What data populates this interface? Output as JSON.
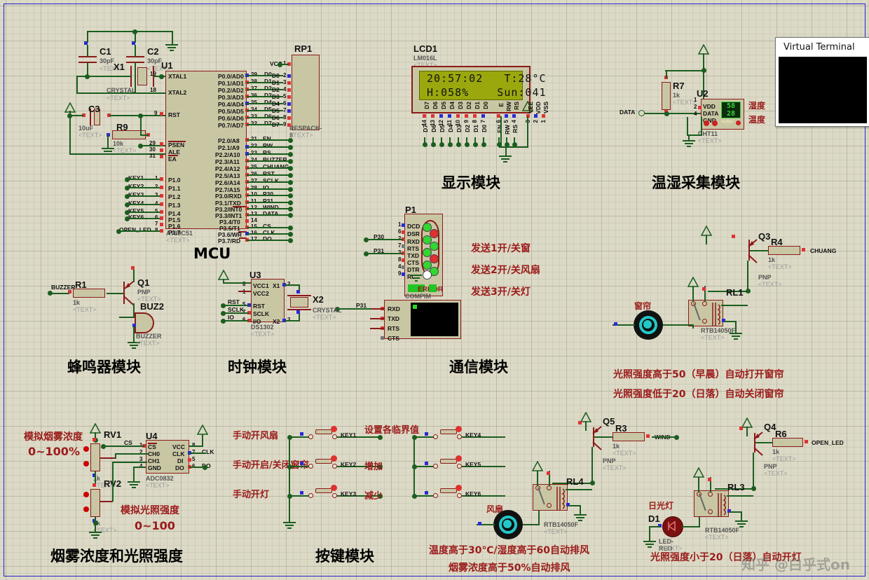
{
  "window": {
    "virtual_terminal_title": "Virtual Terminal"
  },
  "module_titles": {
    "mcu": "MCU",
    "display": "显示模块",
    "temp_humidity": "温湿采集模块",
    "buzzer": "蜂鸣器模块",
    "clock": "时钟模块",
    "communication": "通信模块",
    "smoke_light": "烟雾浓度和光照强度",
    "keys": "按键模块"
  },
  "lcd": {
    "ref": "LCD1",
    "part": "LM016L",
    "text_tag": "<TEXT>",
    "line1": "20:57:02   T:28°C",
    "line2": "H:058%    Sun:041",
    "data_pins": [
      "D7",
      "D6",
      "D5",
      "D4",
      "D3",
      "D2",
      "D1",
      "D0"
    ],
    "data_pin_numbers": [
      "14",
      "13",
      "12",
      "11",
      "10",
      "9",
      "8",
      "7"
    ],
    "ctrl_pins": [
      "E",
      "RW",
      "RS"
    ],
    "ctrl_pin_numbers": [
      "6",
      "5",
      "4"
    ],
    "pwr_pins": [
      "VEE",
      "VDD",
      "VSS"
    ],
    "pwr_pin_numbers": [
      "3",
      "2",
      "1"
    ]
  },
  "mcu": {
    "ref": "U1",
    "part": "AT89C51",
    "text_tag": "<TEXT>",
    "left_pins": [
      {
        "num": "19",
        "label": "XTAL1"
      },
      {
        "num": "18",
        "label": "XTAL2"
      },
      {
        "num": "9",
        "label": "RST"
      },
      {
        "num": "29",
        "label": "PSEN"
      },
      {
        "num": "30",
        "label": "ALE"
      },
      {
        "num": "31",
        "label": "EA"
      },
      {
        "num": "1",
        "label": "P1.0",
        "net": "KEY1"
      },
      {
        "num": "2",
        "label": "P1.1",
        "net": "KEY2"
      },
      {
        "num": "3",
        "label": "P1.2",
        "net": "KEY3"
      },
      {
        "num": "4",
        "label": "P1.3",
        "net": "KEY4"
      },
      {
        "num": "5",
        "label": "P1.4",
        "net": "KEY5"
      },
      {
        "num": "6",
        "label": "P1.5",
        "net": "KEY6"
      },
      {
        "num": "7",
        "label": "P1.6",
        "net": ""
      },
      {
        "num": "8",
        "label": "P1.7",
        "net": "OPEN_LED"
      }
    ],
    "right_pins": [
      {
        "num": "39",
        "label": "P0.0/AD0",
        "net": "D0"
      },
      {
        "num": "38",
        "label": "P0.1/AD1",
        "net": "D1"
      },
      {
        "num": "37",
        "label": "P0.2/AD2",
        "net": "D2"
      },
      {
        "num": "36",
        "label": "P0.3/AD3",
        "net": "D3"
      },
      {
        "num": "35",
        "label": "P0.4/AD4",
        "net": "D4"
      },
      {
        "num": "34",
        "label": "P0.5/AD5",
        "net": "D5"
      },
      {
        "num": "33",
        "label": "P0.6/AD6",
        "net": "D6"
      },
      {
        "num": "32",
        "label": "P0.7/AD7",
        "net": "D7"
      },
      {
        "num": "21",
        "label": "P2.0/A8",
        "net": "EN"
      },
      {
        "num": "22",
        "label": "P2.1/A9",
        "net": "RW"
      },
      {
        "num": "23",
        "label": "P2.2/A10",
        "net": "RS"
      },
      {
        "num": "24",
        "label": "P2.3/A11",
        "net": "BUZZER"
      },
      {
        "num": "25",
        "label": "P2.4/A12",
        "net": "CHUANG"
      },
      {
        "num": "26",
        "label": "P2.5/A13",
        "net": "RST"
      },
      {
        "num": "27",
        "label": "P2.6/A14",
        "net": "SCLK"
      },
      {
        "num": "28",
        "label": "P2.7/A15",
        "net": "IO"
      },
      {
        "num": "10",
        "label": "P3.0/RXD",
        "net": "P30"
      },
      {
        "num": "11",
        "label": "P3.1/TXD",
        "net": "P31"
      },
      {
        "num": "12",
        "label": "P3.2/INT0",
        "net": "WIND"
      },
      {
        "num": "13",
        "label": "P3.3/INT1",
        "net": "DATA"
      },
      {
        "num": "14",
        "label": "P3.4/T0",
        "net": ""
      },
      {
        "num": "15",
        "label": "P3.5/T1",
        "net": "CS"
      },
      {
        "num": "16",
        "label": "P3.6/WR",
        "net": "CLK"
      },
      {
        "num": "17",
        "label": "P3.7/RD",
        "net": "DO"
      }
    ]
  },
  "respack": {
    "ref": "RP1",
    "part": "RESPACK-8",
    "text_tag": "<TEXT>",
    "pins": [
      {
        "num": "1",
        "net": "VCC"
      },
      {
        "num": "2",
        "net": "D0"
      },
      {
        "num": "3",
        "net": "D1"
      },
      {
        "num": "4",
        "net": "D2"
      },
      {
        "num": "5",
        "net": "D3"
      },
      {
        "num": "6",
        "net": "D4"
      },
      {
        "num": "7",
        "net": "D5"
      },
      {
        "num": "8",
        "net": "D6"
      },
      {
        "num": "9",
        "net": "D7"
      }
    ]
  },
  "crystal_circuit": {
    "c1": {
      "ref": "C1",
      "value": "30pF",
      "text_tag": "<TEXT>"
    },
    "c2": {
      "ref": "C2",
      "value": "30pF",
      "text_tag": "<TEXT>"
    },
    "c3": {
      "ref": "C3",
      "value": "10uF",
      "text_tag": "<TEXT>"
    },
    "x1": {
      "ref": "X1",
      "part": "CRYSTAL",
      "text_tag": "<TEXT>"
    },
    "r9": {
      "ref": "R9",
      "value": "10k",
      "text_tag": "<TEXT>"
    }
  },
  "dht": {
    "ref": "U2",
    "part": "DHT11",
    "text_tag": "<TEXT>",
    "pins": [
      {
        "num": "1",
        "label": "VDD"
      },
      {
        "num": "2",
        "label": "DATA"
      },
      {
        "num": "4",
        "label": "GND"
      }
    ],
    "humidity_value": "58",
    "temp_value": "28",
    "display_unit": "%RH",
    "label_top": "湿度",
    "label_bottom": "温度",
    "net": "DATA",
    "r7": {
      "ref": "R7",
      "value": "1k",
      "text_tag": "<TEXT>"
    }
  },
  "clock_module": {
    "ref": "U3",
    "part": "DS1302",
    "text_tag": "<TEXT>",
    "left_pins": [
      {
        "num": "8",
        "label": "VCC1"
      },
      {
        "num": "1",
        "label": "VCC2"
      },
      {
        "num": "5",
        "label": "RST",
        "net": "RST"
      },
      {
        "num": "7",
        "label": "SCLK",
        "net": "SCLK"
      },
      {
        "num": "6",
        "label": "I/O",
        "net": "IO"
      }
    ],
    "right_pins": [
      {
        "num": "2",
        "label": "X1"
      },
      {
        "num": "3",
        "label": "X2"
      }
    ],
    "x2": {
      "ref": "X2",
      "part": "CRYSTAL",
      "text_tag": "<TEXT>"
    }
  },
  "buzzer_module": {
    "r1": {
      "ref": "R1",
      "value": "1k",
      "text_tag": "<TEXT>"
    },
    "q1": {
      "ref": "Q1",
      "type": "PNP",
      "text_tag": "<TEXT>"
    },
    "buz": {
      "ref": "BUZ2",
      "part": "BUZZER",
      "text_tag": "<TEXT>"
    },
    "net": "BUZZER"
  },
  "comport": {
    "ref": "P1",
    "part": "COMPIM",
    "text_tag": "<TEXT>",
    "error_label": "ERROR",
    "pins": [
      {
        "num": "1",
        "label": "DCD"
      },
      {
        "num": "6",
        "label": "DSR"
      },
      {
        "num": "2",
        "label": "RXD",
        "net": "P30"
      },
      {
        "num": "7",
        "label": "RTS"
      },
      {
        "num": "3",
        "label": "TXD",
        "net": "P31"
      },
      {
        "num": "8",
        "label": "CTS"
      },
      {
        "num": "4",
        "label": "DTR"
      },
      {
        "num": "9",
        "label": "RI"
      }
    ]
  },
  "terminal_widget": {
    "net": "P31",
    "pins": [
      "RXD",
      "TXD",
      "RTS",
      "CTS"
    ]
  },
  "comm_notes": [
    "发送1开/关窗",
    "发送2开/关风扇",
    "发送3开/关灯"
  ],
  "adc": {
    "ref": "U4",
    "part": "ADC0832",
    "text_tag": "<TEXT>",
    "left_pins": [
      {
        "num": "1",
        "label": "CS",
        "net": "CS"
      },
      {
        "num": "2",
        "label": "CH0"
      },
      {
        "num": "3",
        "label": "CH1"
      },
      {
        "num": "4",
        "label": "GND"
      }
    ],
    "right_pins": [
      {
        "num": "8",
        "label": "VCC"
      },
      {
        "num": "7",
        "label": "CLK",
        "net": "CLK"
      },
      {
        "num": "5",
        "label": "DI"
      },
      {
        "num": "6",
        "label": "DO",
        "net": "DO"
      }
    ],
    "rv1": {
      "ref": "RV1",
      "value": "1k",
      "text_tag": "<TEXT>"
    },
    "rv2": {
      "ref": "RV2",
      "value": "1k",
      "text_tag": "<TEXT>"
    },
    "note_smoke_title": "模拟烟雾浓度",
    "note_smoke_range": "0~100%",
    "note_light_title": "模拟光照强度",
    "note_light_range": "0~100"
  },
  "keys": [
    {
      "label": "手动开风扇",
      "net": "KEY1"
    },
    {
      "label": "手动开启/关闭窗帘",
      "net": "KEY2"
    },
    {
      "label": "手动开灯",
      "net": "KEY3"
    },
    {
      "label": "设置各临界值",
      "net": "KEY4"
    },
    {
      "label": "增加",
      "net": "KEY5"
    },
    {
      "label": "减少",
      "net": "KEY6"
    }
  ],
  "curtain": {
    "q3": {
      "ref": "Q3",
      "type": "PNP",
      "text_tag": "<TEXT>"
    },
    "r4": {
      "ref": "R4",
      "value": "1k",
      "text_tag": "<TEXT>",
      "net": "CHUANG"
    },
    "rl1": {
      "ref": "RL1",
      "part": "RTB14050F",
      "text_tag": "<TEXT>"
    },
    "label": "窗帘",
    "notes": [
      "光照强度高于50（早晨）自动打开窗帘",
      "光照强度低于20（日落）自动关闭窗帘"
    ]
  },
  "fan": {
    "q5": {
      "ref": "Q5",
      "type": "PNP",
      "text_tag": "<TEXT>"
    },
    "r3": {
      "ref": "R3",
      "value": "1k",
      "text_tag": "<TEXT>",
      "net": "WIND"
    },
    "rl4": {
      "ref": "RL4",
      "part": "RTB14050F",
      "text_tag": "<TEXT>"
    },
    "label": "风扇",
    "notes": [
      "温度高于30℃/湿度高于60自动排风",
      "烟雾浓度高于50%自动排风"
    ]
  },
  "lamp": {
    "q4": {
      "ref": "Q4",
      "type": "PNP",
      "text_tag": "<TEXT>"
    },
    "r6": {
      "ref": "R6",
      "value": "1k",
      "text_tag": "<TEXT>",
      "net": "OPEN_LED"
    },
    "rl3": {
      "ref": "RL3",
      "part": "RTB14050F",
      "text_tag": "<TEXT>"
    },
    "d1": {
      "ref": "D1",
      "part": "LED-RED",
      "text_tag": "<TEXT>"
    },
    "label": "日光灯",
    "note": "光照强度小于20（日落）自动开灯"
  },
  "watermark": "知乎 @白乎式on"
}
